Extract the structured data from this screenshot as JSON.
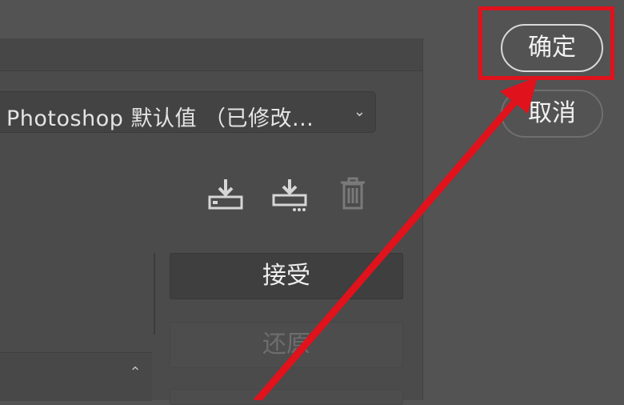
{
  "preset": {
    "label": "Photoshop 默认值 （已修改...",
    "chevron_icon": "chevron-down-icon"
  },
  "toolbar": {
    "icons": [
      "save-preset-icon",
      "export-preset-icon",
      "delete-trash-icon"
    ]
  },
  "buttons": {
    "accept_label": "接受",
    "restore_label": "还原"
  },
  "dialog": {
    "ok_label": "确定",
    "cancel_label": "取消"
  },
  "annotation": {
    "highlight_color": "#e0121c"
  },
  "colors": {
    "background": "#535353",
    "panel": "#4b4b4b"
  }
}
